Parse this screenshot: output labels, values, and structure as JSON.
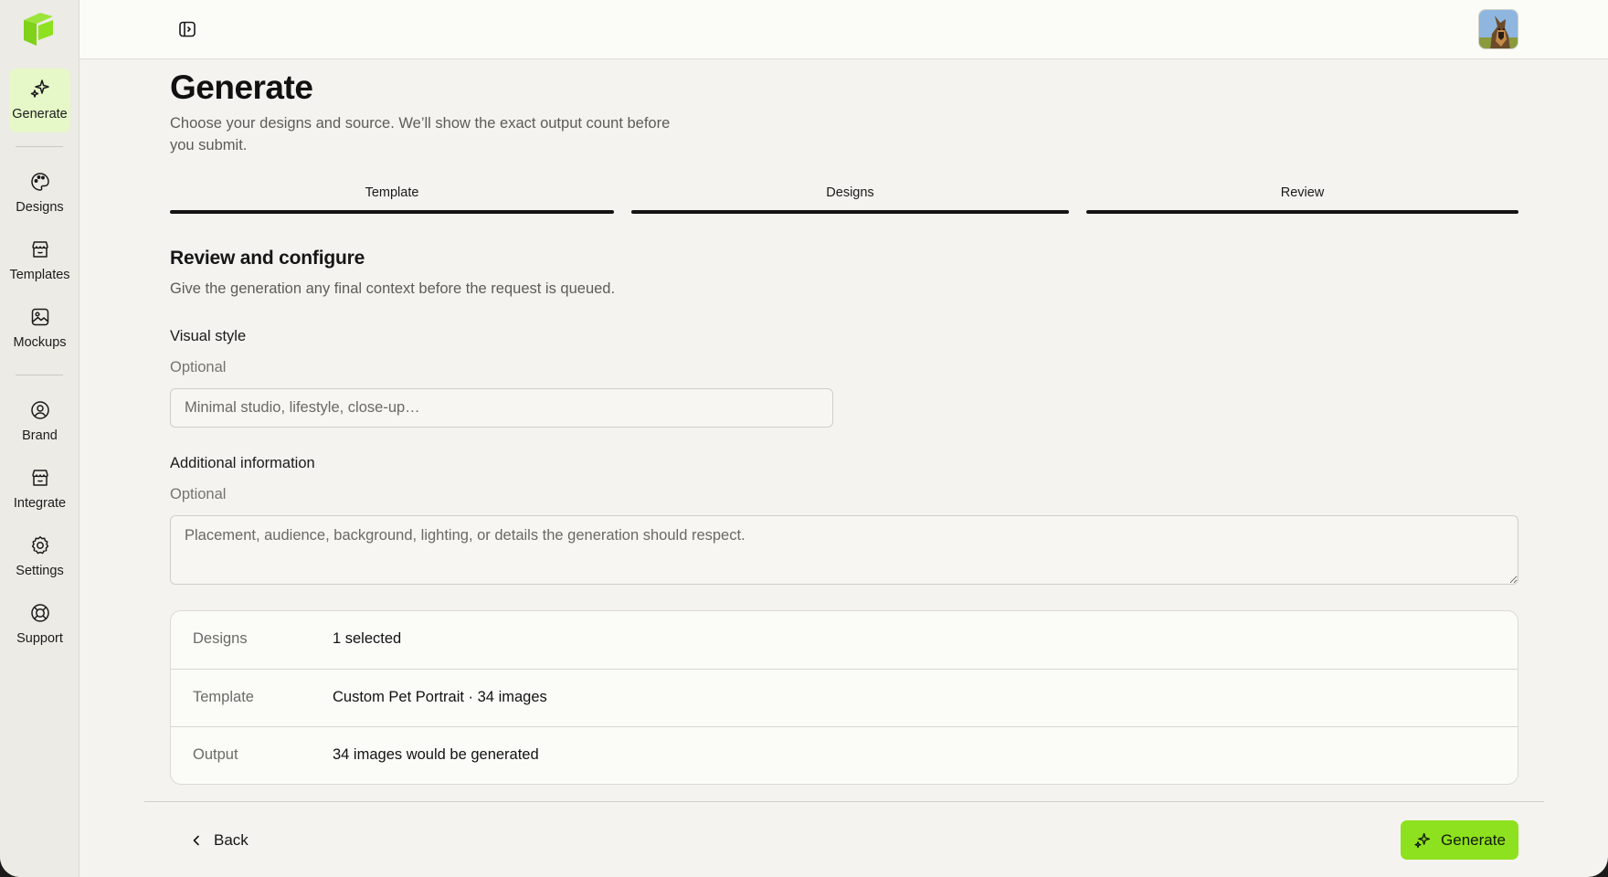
{
  "sidebar": {
    "logo_icon": "brand-logo-icon",
    "items": [
      {
        "label": "Generate",
        "icon": "sparkle-icon",
        "active": true
      },
      {
        "label": "Designs",
        "icon": "palette-icon"
      },
      {
        "label": "Templates",
        "icon": "store-icon"
      },
      {
        "label": "Mockups",
        "icon": "image-icon"
      },
      {
        "label": "Brand",
        "icon": "user-circle-icon"
      },
      {
        "label": "Integrate",
        "icon": "store-icon"
      },
      {
        "label": "Settings",
        "icon": "gear-icon"
      },
      {
        "label": "Support",
        "icon": "lifebuoy-icon"
      }
    ]
  },
  "topbar": {
    "toggle_icon": "panel-toggle-icon",
    "avatar_icon": "dog-avatar-icon"
  },
  "page": {
    "title": "Generate",
    "subtitle": "Choose your designs and source. We’ll show the exact output count before you submit."
  },
  "steps": [
    {
      "label": "Template",
      "complete": true
    },
    {
      "label": "Designs",
      "complete": true
    },
    {
      "label": "Review",
      "complete": true
    }
  ],
  "section": {
    "title": "Review and configure",
    "subtitle": "Give the generation any final context before the request is queued."
  },
  "visual_style": {
    "label": "Visual style",
    "optional": "Optional",
    "value": "",
    "placeholder": "Minimal studio, lifestyle, close-up…"
  },
  "additional_info": {
    "label": "Additional information",
    "optional": "Optional",
    "value": "",
    "placeholder": "Placement, audience, background, lighting, or details the generation should respect."
  },
  "summary": [
    {
      "key": "Designs",
      "value": "1 selected"
    },
    {
      "key": "Template",
      "value": "Custom Pet Portrait · 34 images"
    },
    {
      "key": "Output",
      "value": "34 images would be generated"
    }
  ],
  "footer": {
    "back_label": "Back",
    "generate_label": "Generate",
    "accent": "#8ee11e"
  }
}
